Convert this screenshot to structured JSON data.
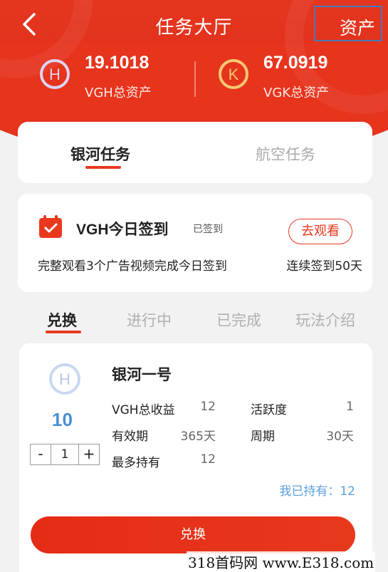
{
  "nav": {
    "title": "任务大厅",
    "assets_label": "资产"
  },
  "stats": [
    {
      "value": "19.1018",
      "label": "VGH总资产",
      "icon": "vgh-logo-icon"
    },
    {
      "value": "67.0919",
      "label": "VGK总资产",
      "icon": "vgk-logo-icon"
    }
  ],
  "task_tabs": [
    {
      "label": "银河任务",
      "active": true
    },
    {
      "label": "航空任务",
      "active": false
    }
  ],
  "checkin": {
    "title": "VGH今日签到",
    "status": "已签到",
    "button": "去观看",
    "description": "完整观看3个广告视频完成今日签到",
    "streak": "连续签到50天"
  },
  "sub_tabs": [
    {
      "label": "兑换",
      "active": true
    },
    {
      "label": "进行中",
      "active": false
    },
    {
      "label": "已完成",
      "active": false
    },
    {
      "label": "玩法介绍",
      "active": false
    }
  ],
  "item": {
    "name": "银河一号",
    "price": "10",
    "quantity": "1",
    "stepper_minus": "-",
    "stepper_plus": "+",
    "fields": {
      "total_income_label": "VGH总收益",
      "total_income_value": "12",
      "activity_label": "活跃度",
      "activity_value": "1",
      "validity_label": "有效期",
      "validity_value": "365天",
      "cycle_label": "周期",
      "cycle_value": "30天",
      "max_hold_label": "最多持有",
      "max_hold_value": "12"
    },
    "held": "我已持有：12",
    "button": "兑换"
  },
  "watermark": "318首码网 www.E318.com",
  "colors": {
    "primary_red": "#e8391f",
    "accent_blue": "#4a8fd4"
  }
}
